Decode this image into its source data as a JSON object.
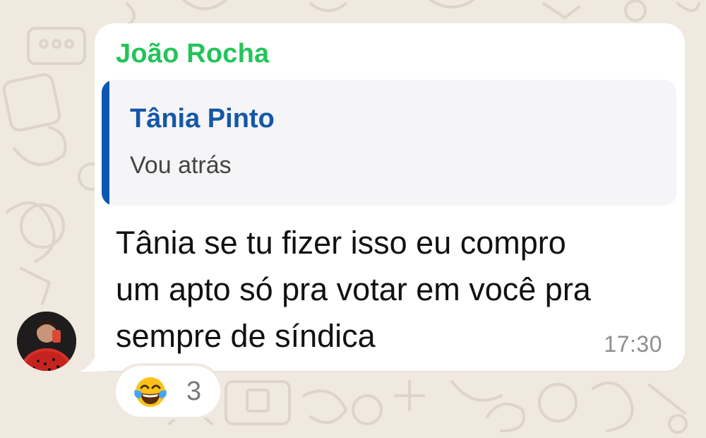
{
  "chat": {
    "message": {
      "sender_name": "João Rocha",
      "sender_color": "#25c35a",
      "quoted": {
        "author": "Tânia Pinto",
        "author_color": "#1457a8",
        "text": "Vou atrás"
      },
      "lines": [
        "Tânia se tu fizer isso eu compro",
        "um apto só pra votar em você pra",
        "sempre de síndica"
      ],
      "time": "17:30"
    },
    "reaction": {
      "emoji_name": "face-with-tears-of-joy-icon",
      "count": "3"
    },
    "avatar": {
      "icon": "avatar"
    },
    "colors": {
      "background": "#efe9df",
      "bubble": "#ffffff",
      "quote_bar": "#0c57b3"
    }
  }
}
